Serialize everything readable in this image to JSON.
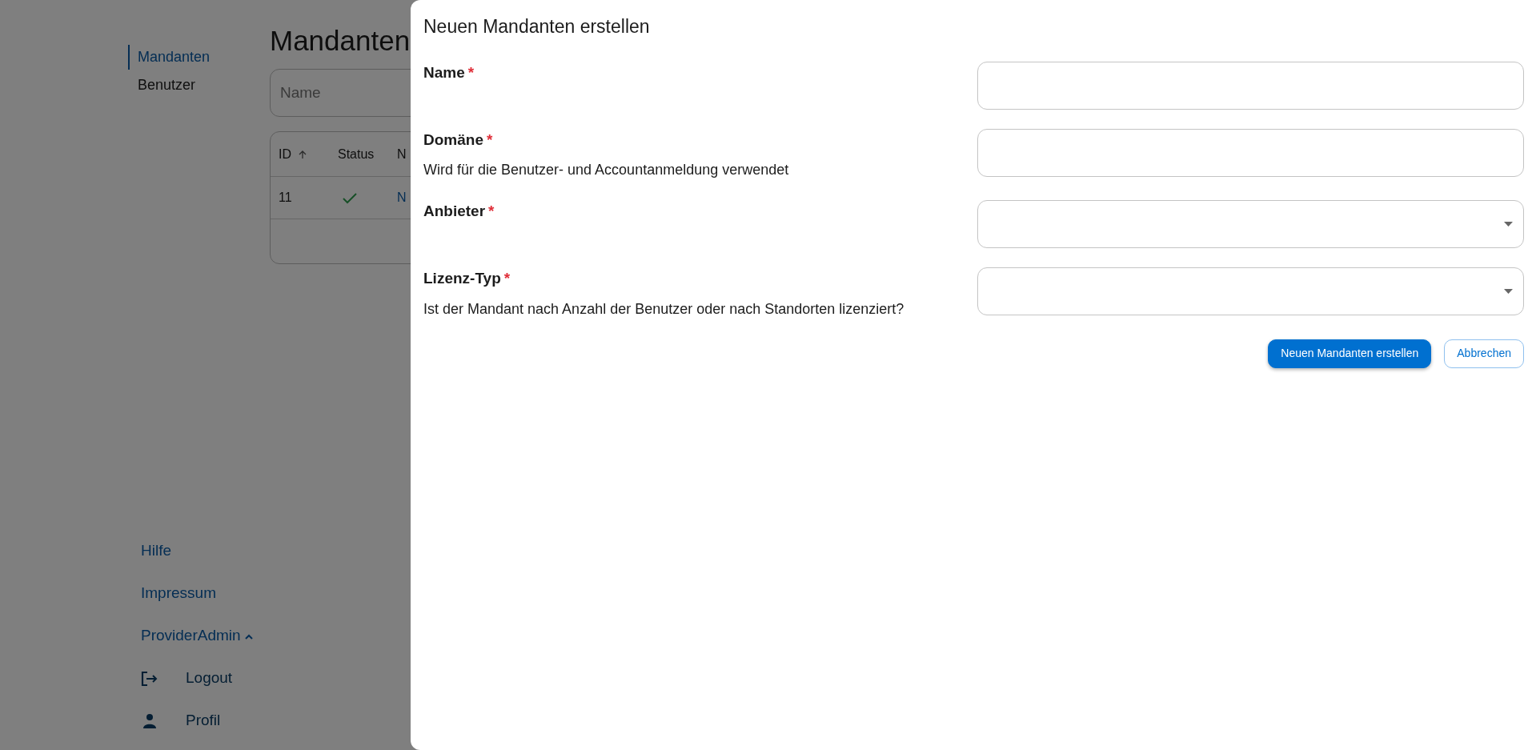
{
  "sidebar": {
    "items": [
      {
        "label": "Mandanten",
        "selected": true
      },
      {
        "label": "Benutzer",
        "selected": false
      }
    ],
    "footer_links": [
      {
        "label": "Hilfe"
      },
      {
        "label": "Impressum"
      }
    ],
    "user_menu": {
      "label": "ProviderAdmin",
      "expanded": true,
      "items": [
        {
          "kind": "logout",
          "label": "Logout"
        },
        {
          "kind": "profile",
          "label": "Profil"
        }
      ]
    }
  },
  "page": {
    "title": "Mandanten",
    "filter": {
      "placeholder": "Name"
    },
    "table": {
      "columns": [
        {
          "label": "ID",
          "sort_ascending": true
        },
        {
          "label": "Status"
        },
        {
          "label": "N"
        }
      ],
      "rows": [
        {
          "cells": [
            {
              "kind": "text",
              "text": "11"
            },
            {
              "kind": "status",
              "ok": true
            },
            {
              "kind": "link",
              "text": "N"
            }
          ]
        }
      ]
    }
  },
  "dialog": {
    "title": "Neuen Mandanten erstellen",
    "fields": [
      {
        "kind": "text",
        "label": "Name",
        "required_mark": "*"
      },
      {
        "kind": "text",
        "label": "Domäne",
        "required_mark": "*",
        "hint": "Wird für die Benutzer- und Accountanmeldung verwendet"
      },
      {
        "kind": "select",
        "label": "Anbieter",
        "required_mark": "*"
      },
      {
        "kind": "select",
        "label": "Lizenz-Typ",
        "required_mark": "*",
        "hint": "Ist der Mandant nach Anzahl der Benutzer oder nach Standorten lizenziert?"
      }
    ],
    "buttons": [
      {
        "kind": "primary",
        "label": "Neuen Mandanten erstellen"
      },
      {
        "kind": "outline",
        "label": "Abbrechen"
      }
    ]
  }
}
